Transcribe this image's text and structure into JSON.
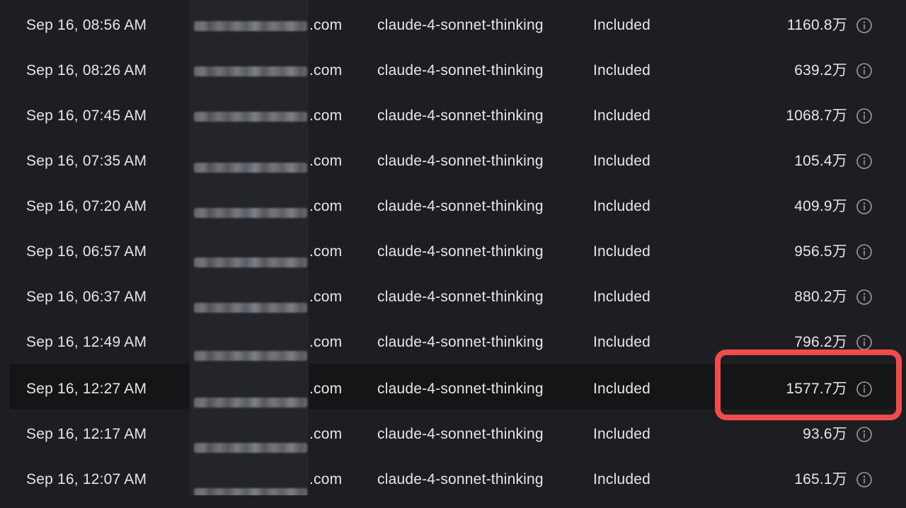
{
  "usage_table": {
    "rows": [
      {
        "date": "Sep 16, 08:56 AM",
        "domain_suffix": ".com",
        "model": "claude-4-sonnet-thinking",
        "kind": "Included",
        "amount": "1160.8万"
      },
      {
        "date": "Sep 16, 08:26 AM",
        "domain_suffix": ".com",
        "model": "claude-4-sonnet-thinking",
        "kind": "Included",
        "amount": "639.2万"
      },
      {
        "date": "Sep 16, 07:45 AM",
        "domain_suffix": ".com",
        "model": "claude-4-sonnet-thinking",
        "kind": "Included",
        "amount": "1068.7万"
      },
      {
        "date": "Sep 16, 07:35 AM",
        "domain_suffix": ".com",
        "model": "claude-4-sonnet-thinking",
        "kind": "Included",
        "amount": "105.4万"
      },
      {
        "date": "Sep 16, 07:20 AM",
        "domain_suffix": ".com",
        "model": "claude-4-sonnet-thinking",
        "kind": "Included",
        "amount": "409.9万"
      },
      {
        "date": "Sep 16, 06:57 AM",
        "domain_suffix": ".com",
        "model": "claude-4-sonnet-thinking",
        "kind": "Included",
        "amount": "956.5万"
      },
      {
        "date": "Sep 16, 06:37 AM",
        "domain_suffix": ".com",
        "model": "claude-4-sonnet-thinking",
        "kind": "Included",
        "amount": "880.2万"
      },
      {
        "date": "Sep 16, 12:49 AM",
        "domain_suffix": ".com",
        "model": "claude-4-sonnet-thinking",
        "kind": "Included",
        "amount": "796.2万"
      },
      {
        "date": "Sep 16, 12:27 AM",
        "domain_suffix": ".com",
        "model": "claude-4-sonnet-thinking",
        "kind": "Included",
        "amount": "1577.7万"
      },
      {
        "date": "Sep 16, 12:17 AM",
        "domain_suffix": ".com",
        "model": "claude-4-sonnet-thinking",
        "kind": "Included",
        "amount": "93.6万"
      },
      {
        "date": "Sep 16, 12:07 AM",
        "domain_suffix": ".com",
        "model": "claude-4-sonnet-thinking",
        "kind": "Included",
        "amount": "165.1万"
      }
    ],
    "highlighted_row": 8,
    "info_icon": "info-circle-icon"
  },
  "colors": {
    "background": "#1d1e22",
    "highlight_row": "#141517",
    "text": "#e6e6e6",
    "annotation_border": "#f04c4c",
    "icon": "#9a9ca0"
  }
}
